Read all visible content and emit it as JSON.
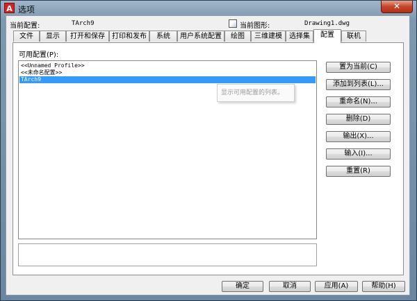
{
  "window": {
    "title": "选项",
    "app_icon": "A",
    "close_label": "✕"
  },
  "header": {
    "current_profile_label": "当前配置:",
    "current_profile_value": "TArch9",
    "current_drawing_label": "当前图形:",
    "current_drawing_value": "Drawing1.dwg"
  },
  "tabs": [
    {
      "label": "文件"
    },
    {
      "label": "显示"
    },
    {
      "label": "打开和保存"
    },
    {
      "label": "打印和发布"
    },
    {
      "label": "系统"
    },
    {
      "label": "用户系统配置"
    },
    {
      "label": "绘图"
    },
    {
      "label": "三维建模"
    },
    {
      "label": "选择集"
    },
    {
      "label": "配置",
      "active": true
    },
    {
      "label": "联机"
    }
  ],
  "profiles": {
    "list_label": "可用配置(P):",
    "items": [
      "<<Unnamed Profile>>",
      "<<未命名配置>>",
      "TArch9"
    ],
    "selected_index": 2,
    "tooltip": "显示可用配置的列表。"
  },
  "side_buttons": {
    "set_current": "置为当前(C)",
    "add_to_list": "添加到列表(L)...",
    "rename": "重命名(N)...",
    "delete": "删除(D)",
    "export": "输出(X)...",
    "import": "输入(I)...",
    "reset": "重置(R)"
  },
  "footer": {
    "ok": "确定",
    "cancel": "取消",
    "apply": "应用(A)",
    "help": "帮助(H)"
  },
  "colors": {
    "selection": "#3399ff",
    "close_button": "#c5452b",
    "app_icon": "#d42323"
  }
}
